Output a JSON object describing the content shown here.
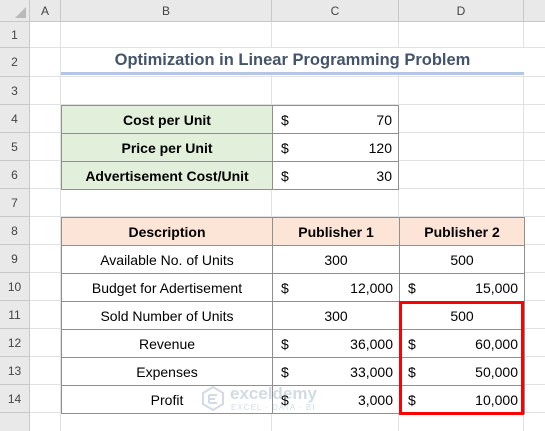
{
  "columns": [
    "A",
    "B",
    "C",
    "D"
  ],
  "rows": [
    "1",
    "2",
    "3",
    "4",
    "5",
    "6",
    "7",
    "8",
    "9",
    "10",
    "11",
    "12",
    "13",
    "14"
  ],
  "title": "Optimization in Linear Programming Problem",
  "inputs": [
    {
      "label": "Cost per Unit",
      "currency": "$",
      "value": "70"
    },
    {
      "label": "Price per Unit",
      "currency": "$",
      "value": "120"
    },
    {
      "label": "Advertisement Cost/Unit",
      "currency": "$",
      "value": "30"
    }
  ],
  "table": {
    "headers": [
      "Description",
      "Publisher 1",
      "Publisher 2"
    ],
    "rows": [
      {
        "description": "Available No. of Units",
        "p1": "300",
        "p2": "500"
      },
      {
        "description": "Budget for Adertisement",
        "p1_currency": "$",
        "p1": "12,000",
        "p2_currency": "$",
        "p2": "15,000"
      },
      {
        "description": "Sold Number of Units",
        "p1": "300",
        "p2": "500"
      },
      {
        "description": "Revenue",
        "p1_currency": "$",
        "p1": "36,000",
        "p2_currency": "$",
        "p2": "60,000"
      },
      {
        "description": "Expenses",
        "p1_currency": "$",
        "p1": "33,000",
        "p2_currency": "$",
        "p2": "50,000"
      },
      {
        "description": "Profit",
        "p1_currency": "$",
        "p1": "3,000",
        "p2_currency": "$",
        "p2": "10,000"
      }
    ]
  },
  "watermark": {
    "name": "exceldemy",
    "sub": "EXCEL · DATA · BI"
  },
  "colors": {
    "input_fill": "#e2efda",
    "header_fill": "#fce4d6",
    "title_text": "#44546a",
    "title_underline": "#b4c6e7",
    "highlight": "#ff0000"
  }
}
